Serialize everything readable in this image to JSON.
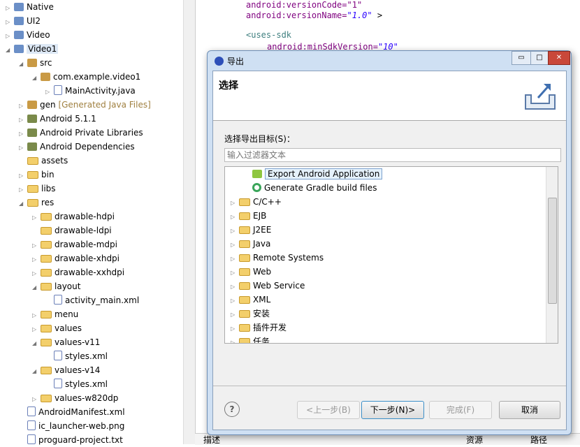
{
  "tree": [
    {
      "label": "Native",
      "level": 0,
      "toggle": "▷",
      "icon": "project"
    },
    {
      "label": "UI2",
      "level": 0,
      "toggle": "▷",
      "icon": "project"
    },
    {
      "label": "Video",
      "level": 0,
      "toggle": "▷",
      "icon": "project"
    },
    {
      "label": "Video1",
      "level": 0,
      "toggle": "◢",
      "icon": "project",
      "selected": true
    },
    {
      "label": "src",
      "level": 1,
      "toggle": "◢",
      "icon": "package"
    },
    {
      "label": "com.example.video1",
      "level": 2,
      "toggle": "◢",
      "icon": "package"
    },
    {
      "label": "MainActivity.java",
      "level": 3,
      "toggle": "▷",
      "icon": "file"
    },
    {
      "label": "gen",
      "extra": "[Generated Java Files]",
      "level": 1,
      "toggle": "▷",
      "icon": "package"
    },
    {
      "label": "Android 5.1.1",
      "level": 1,
      "toggle": "▷",
      "icon": "library"
    },
    {
      "label": "Android Private Libraries",
      "level": 1,
      "toggle": "▷",
      "icon": "library"
    },
    {
      "label": "Android Dependencies",
      "level": 1,
      "toggle": "▷",
      "icon": "library"
    },
    {
      "label": "assets",
      "level": 1,
      "toggle": "",
      "icon": "folder"
    },
    {
      "label": "bin",
      "level": 1,
      "toggle": "▷",
      "icon": "folder"
    },
    {
      "label": "libs",
      "level": 1,
      "toggle": "▷",
      "icon": "folder"
    },
    {
      "label": "res",
      "level": 1,
      "toggle": "◢",
      "icon": "folder"
    },
    {
      "label": "drawable-hdpi",
      "level": 2,
      "toggle": "▷",
      "icon": "folder"
    },
    {
      "label": "drawable-ldpi",
      "level": 2,
      "toggle": "",
      "icon": "folder"
    },
    {
      "label": "drawable-mdpi",
      "level": 2,
      "toggle": "▷",
      "icon": "folder"
    },
    {
      "label": "drawable-xhdpi",
      "level": 2,
      "toggle": "▷",
      "icon": "folder"
    },
    {
      "label": "drawable-xxhdpi",
      "level": 2,
      "toggle": "▷",
      "icon": "folder"
    },
    {
      "label": "layout",
      "level": 2,
      "toggle": "◢",
      "icon": "folder"
    },
    {
      "label": "activity_main.xml",
      "level": 3,
      "toggle": "",
      "icon": "file"
    },
    {
      "label": "menu",
      "level": 2,
      "toggle": "▷",
      "icon": "folder"
    },
    {
      "label": "values",
      "level": 2,
      "toggle": "▷",
      "icon": "folder"
    },
    {
      "label": "values-v11",
      "level": 2,
      "toggle": "◢",
      "icon": "folder"
    },
    {
      "label": "styles.xml",
      "level": 3,
      "toggle": "",
      "icon": "file"
    },
    {
      "label": "values-v14",
      "level": 2,
      "toggle": "◢",
      "icon": "folder"
    },
    {
      "label": "styles.xml",
      "level": 3,
      "toggle": "",
      "icon": "file"
    },
    {
      "label": "values-w820dp",
      "level": 2,
      "toggle": "▷",
      "icon": "folder"
    },
    {
      "label": "AndroidManifest.xml",
      "level": 1,
      "toggle": "",
      "icon": "file"
    },
    {
      "label": "ic_launcher-web.png",
      "level": 1,
      "toggle": "",
      "icon": "file"
    },
    {
      "label": "proguard-project.txt",
      "level": 1,
      "toggle": "",
      "icon": "file"
    }
  ],
  "code": {
    "line0": "android:versionCode=\"1\"",
    "line1_attr": "android:versionName=",
    "line1_val": "\"1.0\"",
    "line1_end": " >",
    "line2": "<uses-sdk",
    "line3_attr": "android:minSdkVersion=",
    "line3_val": "\"10\""
  },
  "bottom": {
    "col1": "描述",
    "col2": "资源",
    "col3": "路径"
  },
  "dialog": {
    "title": "导出",
    "header": "选择",
    "label": "选择导出目标(S)：",
    "filter_placeholder": "输入过滤器文本",
    "items": [
      {
        "label": "Export Android Application",
        "level": 1,
        "toggle": "",
        "icon": "android",
        "selected": true
      },
      {
        "label": "Generate Gradle build files",
        "level": 1,
        "toggle": "",
        "icon": "gradle"
      },
      {
        "label": "C/C++",
        "level": 0,
        "toggle": "▷",
        "icon": "folder"
      },
      {
        "label": "EJB",
        "level": 0,
        "toggle": "▷",
        "icon": "folder"
      },
      {
        "label": "J2EE",
        "level": 0,
        "toggle": "▷",
        "icon": "folder"
      },
      {
        "label": "Java",
        "level": 0,
        "toggle": "▷",
        "icon": "folder"
      },
      {
        "label": "Remote Systems",
        "level": 0,
        "toggle": "▷",
        "icon": "folder"
      },
      {
        "label": "Web",
        "level": 0,
        "toggle": "▷",
        "icon": "folder"
      },
      {
        "label": "Web Service",
        "level": 0,
        "toggle": "▷",
        "icon": "folder"
      },
      {
        "label": "XML",
        "level": 0,
        "toggle": "▷",
        "icon": "folder"
      },
      {
        "label": "安装",
        "level": 0,
        "toggle": "▷",
        "icon": "folder"
      },
      {
        "label": "插件开发",
        "level": 0,
        "toggle": "▷",
        "icon": "folder"
      },
      {
        "label": "任务",
        "level": 0,
        "toggle": "▷",
        "icon": "folder"
      }
    ],
    "buttons": {
      "back": "<上一步(B)",
      "next": "下一步(N)>",
      "finish": "完成(F)",
      "cancel": "取消"
    }
  }
}
